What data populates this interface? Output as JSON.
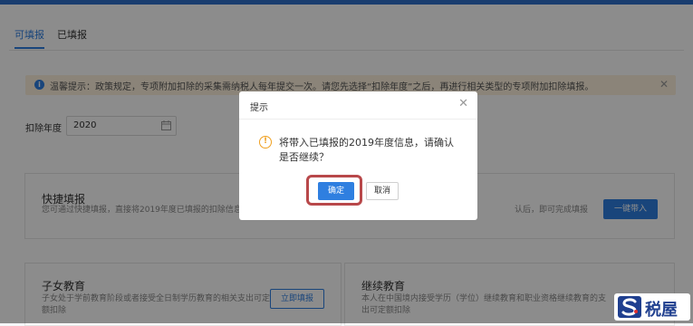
{
  "tabs": [
    {
      "label": "可填报",
      "active": true
    },
    {
      "label": "已填报",
      "active": false
    }
  ],
  "notice": {
    "text": "温馨提示：政策规定，专项附加扣除的采集需纳税人每年提交一次。请您先选择“扣除年度”之后，再进行相关类型的专项附加扣除填报。",
    "info_icon": "info-icon",
    "close_icon": "close-icon"
  },
  "year_filter": {
    "label": "扣除年度",
    "value": "2020",
    "icon": "calendar-icon"
  },
  "quick_fill": {
    "title": "快捷填报",
    "desc_left": "您可通过快捷填报，直接将2019年度已填报的扣除信息",
    "desc_right": "认后，即可完成填报",
    "button": "一键带入"
  },
  "cards": [
    {
      "title": "子女教育",
      "desc": "子女处于学前教育阶段或者接受全日制学历教育的相关支出可定额扣除",
      "button": "立即填报"
    },
    {
      "title": "继续教育",
      "desc": "本人在中国境内接受学历（学位）继续教育和职业资格继续教育的支出可定额扣除"
    }
  ],
  "dialog": {
    "title": "提示",
    "message": "将带入已填报的2019年度信息，请确认是否继续？",
    "confirm": "确定",
    "cancel": "取消",
    "warn_icon": "warning-icon",
    "close_icon": "close-icon"
  },
  "watermark": {
    "text": "税屋",
    "logo_icon": "shuiwu-logo"
  },
  "colors": {
    "primary": "#2f7fe0",
    "topbar": "#2f6fcb",
    "warning": "#f0a020",
    "highlight": "#b8484a",
    "notice_bg": "#fdf1dc"
  }
}
